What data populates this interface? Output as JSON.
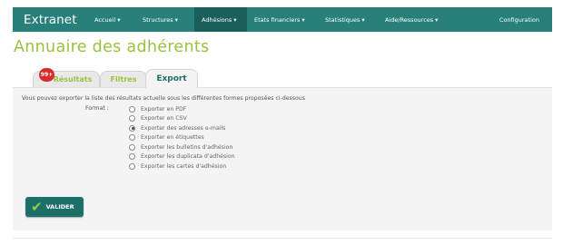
{
  "navbar": {
    "brand": "Extranet",
    "items": [
      {
        "label": "Accueil",
        "caret": "▾"
      },
      {
        "label": "Structures",
        "caret": "▾"
      },
      {
        "label": "Adhésions",
        "caret": "▾"
      },
      {
        "label": "Etats financiers",
        "caret": "▾"
      },
      {
        "label": "Statistiques",
        "caret": "▾"
      },
      {
        "label": "Aide/Ressources",
        "caret": "▾"
      }
    ],
    "active_item": "Adhésions",
    "config_label": "Configuration"
  },
  "page": {
    "title": "Annuaire des adhérents"
  },
  "tabs": [
    {
      "label": "Résultats",
      "badge": "99+"
    },
    {
      "label": "Filtres"
    },
    {
      "label": "Export"
    }
  ],
  "active_tab": "Export",
  "export": {
    "intro": "Vous pouvez exporter la liste des résultats actuelle sous les différentes formes proposées ci-dessous",
    "format_label": "Format :",
    "options": [
      "Exporter en PDF",
      "Exporter en CSV",
      "Exporter des adresses e-mails",
      "Exporter en étiquettes",
      "Exporter les bulletins d'adhésion",
      "Exporter les duplicata d'adhésion",
      "Exporter les cartes d'adhésion"
    ],
    "selected": "Exporter des adresses e-mails",
    "submit_label": "VALIDER",
    "submit_icon": "check-icon"
  },
  "colors": {
    "navbar": "#27807a",
    "navbar_active": "#1b5f5a",
    "title": "#9cc141",
    "badge": "#d62c2c",
    "button": "#1d6f6a"
  }
}
